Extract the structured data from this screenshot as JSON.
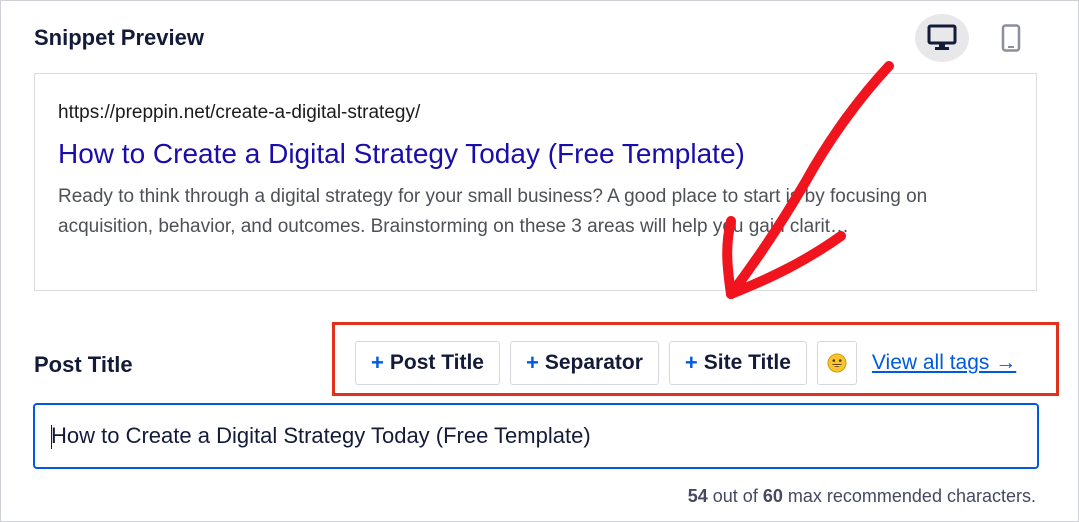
{
  "section": {
    "title": "Snippet Preview"
  },
  "device_toggle": {
    "desktop_icon": "desktop-icon",
    "mobile_icon": "mobile-icon",
    "active": "desktop"
  },
  "snippet": {
    "url": "https://preppin.net/create-a-digital-strategy/",
    "title": "How to Create a Digital Strategy Today (Free Template)",
    "description": "Ready to think through a digital strategy for your small business? A good place to start is by focusing on acquisition, behavior, and outcomes. Brainstorming on these 3 areas will help you gain clarit…"
  },
  "post_title": {
    "label": "Post Title",
    "tags": [
      {
        "plus": "+",
        "label": "Post Title"
      },
      {
        "plus": "+",
        "label": "Separator"
      },
      {
        "plus": "+",
        "label": "Site Title"
      }
    ],
    "emoji_icon": "smiley-emoji-icon",
    "view_all_label": "View all tags →",
    "input_value": "How to Create a Digital Strategy Today (Free Template)"
  },
  "char_count": {
    "current": "54",
    "out_of_text": "out of",
    "max": "60",
    "suffix": "max recommended characters."
  },
  "colors": {
    "accent": "#005ae0",
    "highlight_box": "#e0311e",
    "arrow": "#f0141e",
    "link_title": "#1a0dab"
  }
}
